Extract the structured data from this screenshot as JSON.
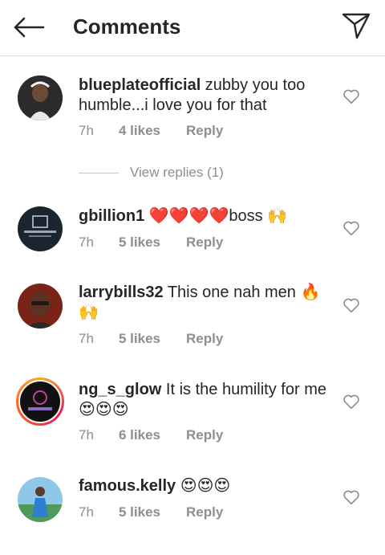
{
  "header": {
    "title": "Comments",
    "back_icon": "arrow-left-icon",
    "send_icon": "paper-plane-icon"
  },
  "comments": [
    {
      "username": "blueplateofficial",
      "text": " zubby you too humble...i love you for that",
      "time": "7h",
      "likes": "4 likes",
      "reply": "Reply",
      "view_replies": "View replies (1)"
    },
    {
      "username": "gbillion1",
      "text": " ❤️❤️❤️❤️boss 🙌",
      "time": "7h",
      "likes": "5 likes",
      "reply": "Reply"
    },
    {
      "username": "larrybills32",
      "text": " This one nah men 🔥 🙌",
      "time": "7h",
      "likes": "5 likes",
      "reply": "Reply"
    },
    {
      "username": "ng_s_glow",
      "text": " It is the humility for me😍😍😍",
      "time": "7h",
      "likes": "6 likes",
      "reply": "Reply"
    },
    {
      "username": "famous.kelly",
      "text": " 😍😍😍",
      "time": "7h",
      "likes": "5 likes",
      "reply": "Reply"
    }
  ],
  "colors": {
    "text": "#262626",
    "secondary": "#8e8e8e",
    "divider": "#dbdbdb"
  }
}
